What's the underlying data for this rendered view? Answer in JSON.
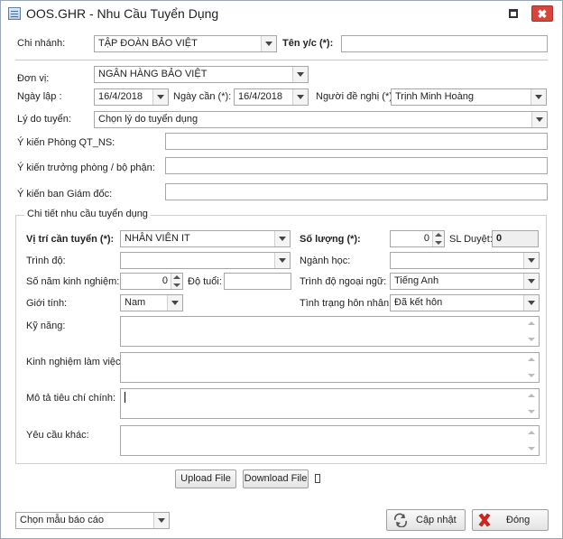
{
  "window": {
    "title": "OOS.GHR - Nhu Cầu Tuyển Dụng",
    "close_glyph": "✖"
  },
  "header": {
    "chi_nhanh_label": "Chi nhánh:",
    "chi_nhanh_value": "TẬP ĐOÀN BẢO VIỆT",
    "ten_yc_label": "Tên y/c (*):",
    "ten_yc_value": ""
  },
  "form": {
    "don_vi_label": "Đơn vị:",
    "don_vi_value": "NGÂN HÀNG BẢO VIỆT",
    "ngay_lap_label": "Ngày lập :",
    "ngay_lap_value": "16/4/2018",
    "ngay_can_label": "Ngày cần (*):",
    "ngay_can_value": "16/4/2018",
    "nguoi_de_nghi_label": "Người đề nghị (*):",
    "nguoi_de_nghi_value": "Trịnh Minh Hoàng",
    "ly_do_label": "Lý do tuyển:",
    "ly_do_placeholder": "Chọn lý do tuyển dụng",
    "y_kien_qt_label": "Ý kiến Phòng QT_NS:",
    "y_kien_tp_label": "Ý kiến trưởng phòng / bộ phận:",
    "y_kien_gd_label": "Ý kiến ban Giám đốc:"
  },
  "detail": {
    "group_title": "Chi tiết nhu cầu tuyển dụng",
    "vi_tri_label": "Vị trí cần tuyển (*):",
    "vi_tri_value": "NHÂN VIÊN IT",
    "so_luong_label": "Số lượng (*):",
    "so_luong_value": "0",
    "sl_duyet_label": "SL Duyệt:",
    "sl_duyet_value": "0",
    "trinh_do_label": "Trình độ:",
    "nganh_hoc_label": "Ngành học:",
    "so_nam_label": "Số năm kinh nghiệm:",
    "so_nam_value": "0",
    "do_tuoi_label": "Độ tuổi:",
    "ngoai_ngu_label": "Trình độ ngoại ngữ:",
    "ngoai_ngu_value": "Tiếng Anh",
    "gioi_tinh_label": "Giới tính:",
    "gioi_tinh_value": "Nam",
    "hon_nhan_label": "Tình trạng hôn nhân:",
    "hon_nhan_value": "Đã kết hôn",
    "ky_nang_label": "Kỹ năng:",
    "kinh_nghiem_label": "Kinh nghiệm làm việc:",
    "mo_ta_label": "Mô tả tiêu chí chính:",
    "yeu_cau_label": "Yêu cầu khác:"
  },
  "buttons": {
    "upload": "Upload File",
    "download": "Download File",
    "cap_nhat": "Cập nhật",
    "dong": "Đóng"
  },
  "footer": {
    "report_template_placeholder": "Chọn mẫu báo cáo"
  },
  "colors": {
    "close_red": "#d9453a",
    "border": "#a7a7a7",
    "x_icon_red": "#d8231c"
  }
}
